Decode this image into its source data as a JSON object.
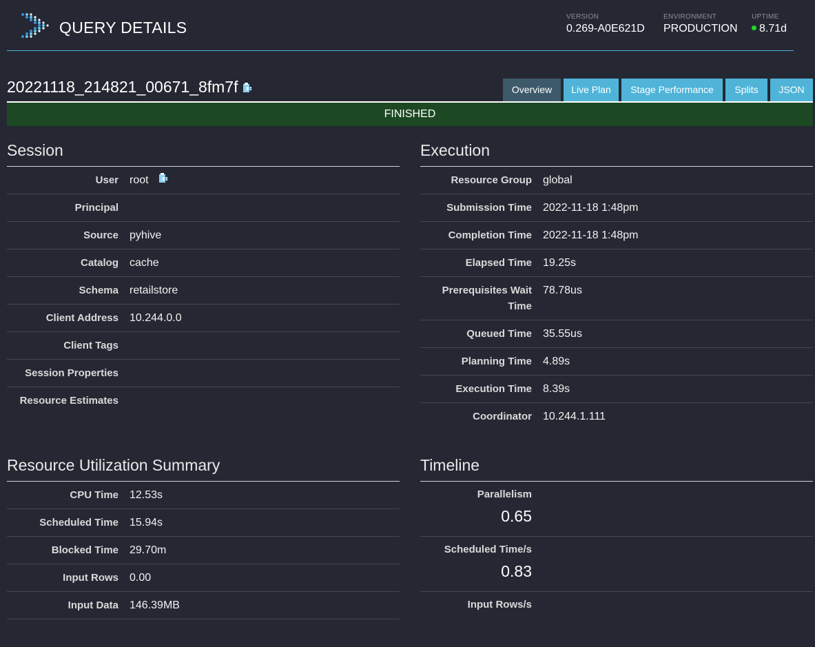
{
  "header": {
    "title": "QUERY DETAILS",
    "version_label": "VERSION",
    "version": "0.269-A0E621D",
    "environment_label": "ENVIRONMENT",
    "environment": "PRODUCTION",
    "uptime_label": "UPTIME",
    "uptime": "8.71d",
    "uptime_status_color": "#1edc1e"
  },
  "query": {
    "id": "20221118_214821_00671_8fm7f",
    "state": "FINISHED",
    "state_color": "#1c4924"
  },
  "tabs": [
    {
      "label": "Overview",
      "active": true
    },
    {
      "label": "Live Plan",
      "active": false
    },
    {
      "label": "Stage Performance",
      "active": false
    },
    {
      "label": "Splits",
      "active": false
    },
    {
      "label": "JSON",
      "active": false
    }
  ],
  "session": {
    "title": "Session",
    "rows": [
      {
        "key": "User",
        "value": "root"
      },
      {
        "key": "Principal",
        "value": ""
      },
      {
        "key": "Source",
        "value": "pyhive"
      },
      {
        "key": "Catalog",
        "value": "cache"
      },
      {
        "key": "Schema",
        "value": "retailstore"
      },
      {
        "key": "Client Address",
        "value": "10.244.0.0"
      },
      {
        "key": "Client Tags",
        "value": ""
      },
      {
        "key": "Session Properties",
        "value": ""
      },
      {
        "key": "Resource Estimates",
        "value": ""
      }
    ]
  },
  "execution": {
    "title": "Execution",
    "rows": [
      {
        "key": "Resource Group",
        "value": "global"
      },
      {
        "key": "Submission Time",
        "value": "2022-11-18 1:48pm"
      },
      {
        "key": "Completion Time",
        "value": "2022-11-18 1:48pm"
      },
      {
        "key": "Elapsed Time",
        "value": "19.25s"
      },
      {
        "key": "Prerequisites Wait Time",
        "value": "78.78us"
      },
      {
        "key": "Queued Time",
        "value": "35.55us"
      },
      {
        "key": "Planning Time",
        "value": "4.89s"
      },
      {
        "key": "Execution Time",
        "value": "8.39s"
      },
      {
        "key": "Coordinator",
        "value": "10.244.1.111"
      }
    ]
  },
  "resource_utilization": {
    "title": "Resource Utilization Summary",
    "rows": [
      {
        "key": "CPU Time",
        "value": "12.53s"
      },
      {
        "key": "Scheduled Time",
        "value": "15.94s"
      },
      {
        "key": "Blocked Time",
        "value": "29.70m"
      },
      {
        "key": "Input Rows",
        "value": "0.00"
      },
      {
        "key": "Input Data",
        "value": "146.39MB"
      }
    ]
  },
  "timeline": {
    "title": "Timeline",
    "rows": [
      {
        "key": "Parallelism",
        "value": "0.65"
      },
      {
        "key": "Scheduled Time/s",
        "value": "0.83"
      },
      {
        "key": "Input Rows/s",
        "value": ""
      }
    ]
  },
  "colors": {
    "background": "#252833",
    "accent": "#4fb4d8",
    "active_tab": "#3d5a6b"
  }
}
